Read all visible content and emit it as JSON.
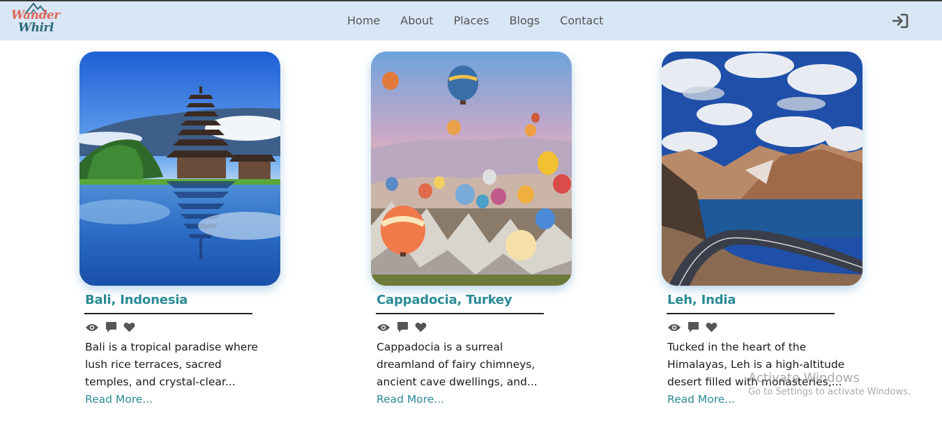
{
  "brand": {
    "line1": "Wander",
    "line2": "Whirl"
  },
  "nav": {
    "items": [
      {
        "label": "Home"
      },
      {
        "label": "About"
      },
      {
        "label": "Places"
      },
      {
        "label": "Blogs"
      },
      {
        "label": "Contact"
      }
    ],
    "login_icon": "sign-in-icon"
  },
  "cards": [
    {
      "title": "Bali, Indonesia",
      "image": "bali-temple-lake-photo",
      "icons": [
        "eye-icon",
        "comment-icon",
        "heart-icon"
      ],
      "lines": [
        "Bali is a tropical paradise where",
        "lush rice terraces, sacred",
        "temples, and crystal-clear..."
      ],
      "read_more": "Read More..."
    },
    {
      "title": "Cappadocia, Turkey",
      "image": "cappadocia-hot-air-balloons-photo",
      "icons": [
        "eye-icon",
        "comment-icon",
        "heart-icon"
      ],
      "lines": [
        "Cappadocia is a surreal",
        "dreamland of fairy chimneys,",
        "ancient cave dwellings, and..."
      ],
      "read_more": "Read More..."
    },
    {
      "title": "Leh, India",
      "image": "leh-mountain-road-lake-photo",
      "icons": [
        "eye-icon",
        "comment-icon",
        "heart-icon"
      ],
      "lines": [
        "Tucked in the heart of the",
        "Himalayas, Leh is a high-altitude",
        "desert filled with monasteries,..."
      ],
      "read_more": "Read More..."
    }
  ],
  "watermark": {
    "title": "Activate Windows",
    "subtitle": "Go to Settings to activate Windows."
  },
  "colors": {
    "navbar": "#d9e6f5",
    "accent": "#2a8a96",
    "brand_red": "#e0675a",
    "brand_teal": "#2e6b7a"
  }
}
